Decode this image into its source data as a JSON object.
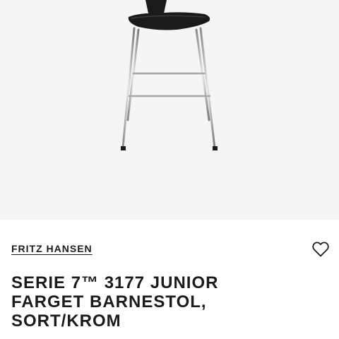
{
  "product": {
    "brand": "FRITZ HANSEN",
    "title_lines": [
      "SERIE 7™ 3177 JUNIOR",
      "FARGET BARNESTOL,",
      "SORT/KROM"
    ]
  },
  "icons": {
    "wishlist": "heart-outline-icon"
  },
  "colors": {
    "text": "#1b1b1b",
    "image_background": "#f5f5f5",
    "seat": "#1a1a1a",
    "frame": "#b9b9b9"
  }
}
